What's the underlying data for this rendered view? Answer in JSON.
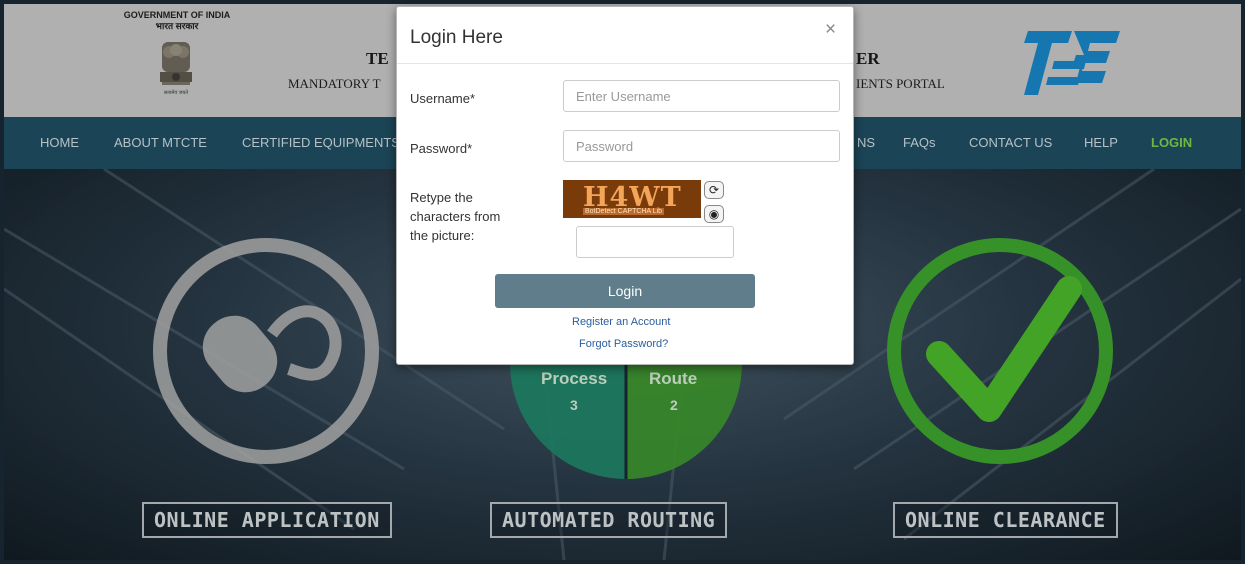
{
  "header": {
    "gov_line1": "GOVERNMENT OF INDIA",
    "gov_line2": "भारत सरकार",
    "emblem_motto": "सत्यमेव जयते",
    "title_left": "TE",
    "subtitle_left": "MANDATORY T",
    "title_right": "ER",
    "subtitle_right": "IENTS PORTAL",
    "logo_icon": "tec-logo"
  },
  "nav": {
    "items": [
      {
        "label": "HOME"
      },
      {
        "label": "ABOUT MTCTE"
      },
      {
        "label": "CERTIFIED EQUIPMENTS"
      },
      {
        "label": "NS"
      },
      {
        "label": "FAQs"
      },
      {
        "label": "CONTACT US"
      },
      {
        "label": "HELP"
      },
      {
        "label": "LOGIN"
      }
    ]
  },
  "hero": {
    "label_1": "ONLINE APPLICATION",
    "label_2": "AUTOMATED ROUTING",
    "label_3": "ONLINE CLEARANCE",
    "pie_left_text": "Process",
    "pie_left_num": "3",
    "pie_right_text": "Route",
    "pie_right_num": "2"
  },
  "modal": {
    "title": "Login Here",
    "close": "×",
    "username_label": "Username*",
    "username_placeholder": "Enter Username",
    "password_label": "Password*",
    "password_placeholder": "Password",
    "captcha_label_1": "Retype the",
    "captcha_label_2": "characters from",
    "captcha_label_3": "the picture:",
    "captcha_text": "H4WT",
    "captcha_sub": "BotDetect CAPTCHA Lib",
    "login_button": "Login",
    "register_link": "Register an Account",
    "forgot_link": "Forgot Password?"
  },
  "colors": {
    "nav_bg": "#1f4e62",
    "nav_active": "#7fd14a",
    "login_button": "#607d8b",
    "header_bg": "#c9c9c9"
  }
}
